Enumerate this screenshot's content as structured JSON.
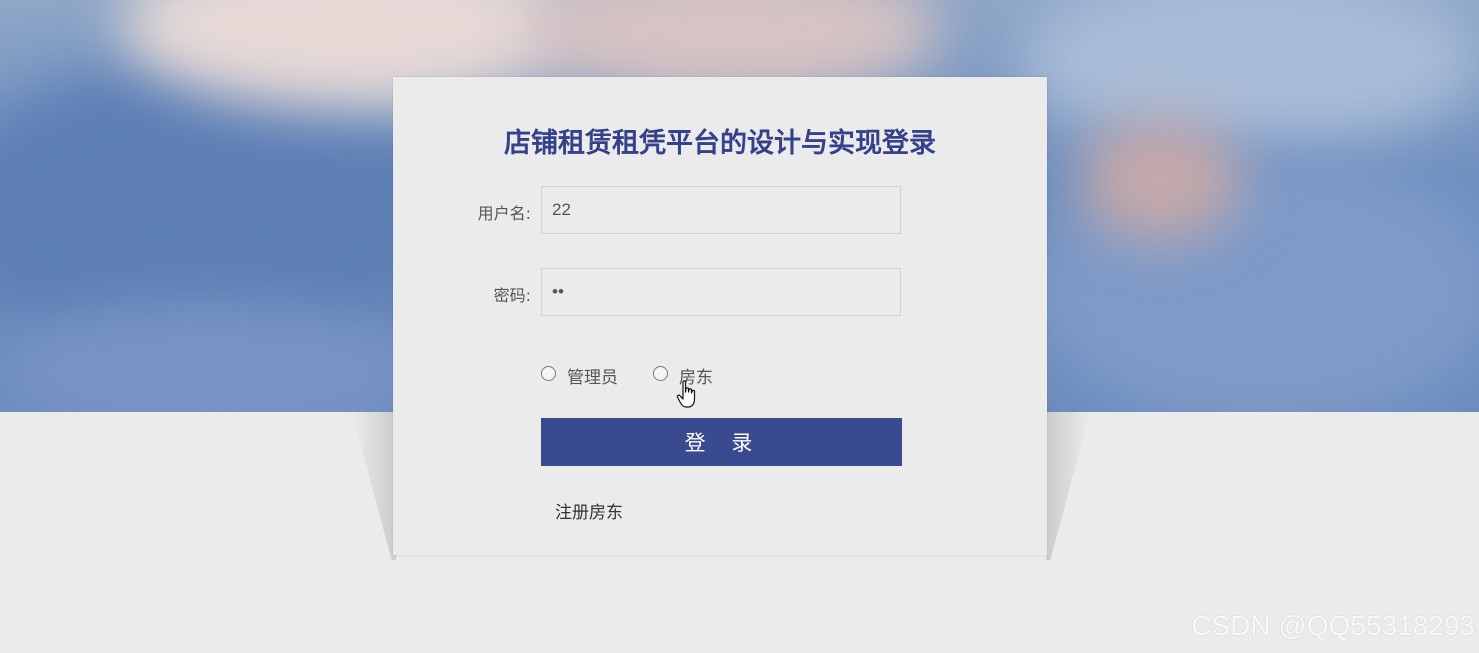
{
  "login": {
    "title": "店铺租赁租凭平台的设计与实现登录",
    "username_label": "用户名:",
    "username_value": "22",
    "password_label": "密码:",
    "password_value": "••",
    "roles": [
      {
        "label": "管理员",
        "selected": false
      },
      {
        "label": "房东",
        "selected": false
      }
    ],
    "login_button": "登 录",
    "register_link": "注册房东"
  },
  "watermark": "CSDN @QQ55318293",
  "colors": {
    "accent": "#3a4a8f",
    "title": "#35418a",
    "background": "#ebebeb"
  }
}
